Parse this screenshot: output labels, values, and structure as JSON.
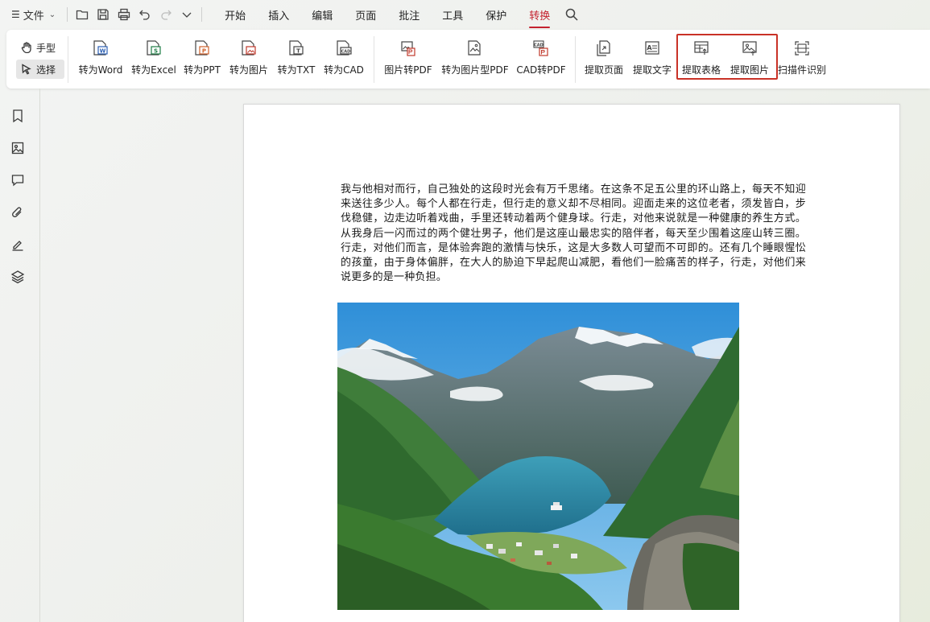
{
  "menubar": {
    "file_label": "文件",
    "tabs": [
      {
        "label": "开始"
      },
      {
        "label": "插入"
      },
      {
        "label": "编辑"
      },
      {
        "label": "页面"
      },
      {
        "label": "批注"
      },
      {
        "label": "工具"
      },
      {
        "label": "保护"
      },
      {
        "label": "转换",
        "active": true
      }
    ]
  },
  "ribbon": {
    "hand_label": "手型",
    "select_label": "选择",
    "buttons": [
      {
        "label": "转为Word",
        "icon": "to-word-icon"
      },
      {
        "label": "转为Excel",
        "icon": "to-excel-icon"
      },
      {
        "label": "转为PPT",
        "icon": "to-ppt-icon"
      },
      {
        "label": "转为图片",
        "icon": "to-image-icon"
      },
      {
        "label": "转为TXT",
        "icon": "to-txt-icon"
      },
      {
        "label": "转为CAD",
        "icon": "to-cad-icon"
      },
      {
        "label": "图片转PDF",
        "icon": "image-to-pdf-icon"
      },
      {
        "label": "转为图片型PDF",
        "icon": "to-image-pdf-icon"
      },
      {
        "label": "CAD转PDF",
        "icon": "cad-to-pdf-icon"
      },
      {
        "label": "提取页面",
        "icon": "extract-page-icon"
      },
      {
        "label": "提取文字",
        "icon": "extract-text-icon"
      },
      {
        "label": "提取表格",
        "icon": "extract-table-icon"
      },
      {
        "label": "提取图片",
        "icon": "extract-image-icon"
      },
      {
        "label": "扫描件识别",
        "icon": "scan-ocr-icon"
      }
    ]
  },
  "sidebar": {
    "items": [
      "bookmark-icon",
      "thumbnail-icon",
      "comment-icon",
      "attachment-icon",
      "signature-icon",
      "layers-icon"
    ]
  },
  "document": {
    "paragraph": "我与他相对而行，自己独处的这段时光会有万千思绪。在这条不足五公里的环山路上，每天不知迎来送往多少人。每个人都在行走，但行走的意义却不尽相同。迎面走来的这位老者，须发皆白，步伐稳健，边走边听着戏曲，手里还转动着两个健身球。行走，对他来说就是一种健康的养生方式。从我身后一闪而过的两个健壮男子，他们是这座山最忠实的陪伴者，每天至少围着这座山转三圈。行走，对他们而言，是体验奔跑的激情与快乐，这是大多数人可望而不可即的。还有几个睡眼惺忪的孩童，由于身体偏胖，在大人的胁迫下早起爬山减肥，看他们一脸痛苦的样子，行走，对他们来说更多的是一种负担。"
  },
  "colors": {
    "accent": "#c4222f",
    "highlight_border": "#c93227"
  }
}
